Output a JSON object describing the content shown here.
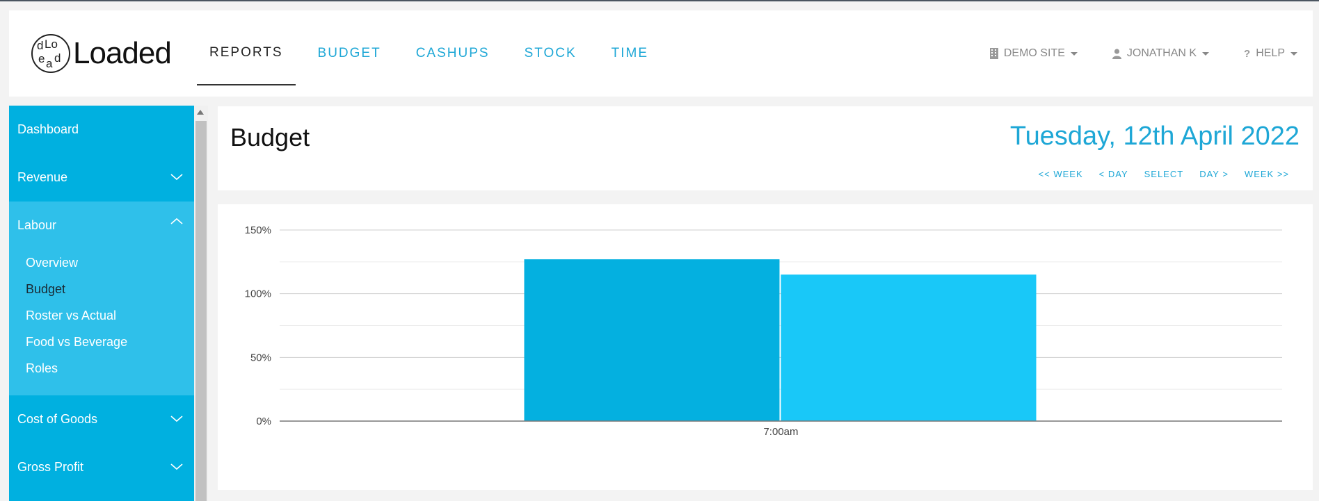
{
  "logo": {
    "mark_letters": [
      "d",
      "Lo",
      "e",
      "a",
      "d"
    ],
    "text": "Loaded"
  },
  "nav": [
    {
      "label": "REPORTS",
      "active": true
    },
    {
      "label": "BUDGET",
      "active": false
    },
    {
      "label": "CASHUPS",
      "active": false
    },
    {
      "label": "STOCK",
      "active": false
    },
    {
      "label": "TIME",
      "active": false
    }
  ],
  "user_menu": {
    "site": {
      "label": "DEMO SITE",
      "icon": "building-icon"
    },
    "user": {
      "label": "JONATHAN K",
      "icon": "user-icon"
    },
    "help": {
      "label": "HELP",
      "icon": "question-icon"
    }
  },
  "sidebar": {
    "items": [
      {
        "label": "Dashboard",
        "expandable": false
      },
      {
        "label": "Revenue",
        "expandable": true,
        "expanded": false
      },
      {
        "label": "Labour",
        "expandable": true,
        "expanded": true,
        "children": [
          "Overview",
          "Budget",
          "Roster vs Actual",
          "Food vs Beverage",
          "Roles"
        ],
        "current_child": "Budget"
      },
      {
        "label": "Cost of Goods",
        "expandable": true,
        "expanded": false
      },
      {
        "label": "Gross Profit",
        "expandable": true,
        "expanded": false
      }
    ]
  },
  "page": {
    "title": "Budget",
    "date": "Tuesday, 12th April 2022",
    "date_nav": [
      "<< WEEK",
      "< DAY",
      "SELECT",
      "DAY >",
      "WEEK >>"
    ]
  },
  "colors": {
    "accent": "#1ea7d6",
    "sidebar": "#00b0e0",
    "sidebar_open": "#2fc0ea",
    "bar1": "#04b0e0",
    "bar2": "#19c8f8"
  },
  "chart_data": {
    "type": "bar",
    "categories": [
      "7:00am"
    ],
    "series": [
      {
        "values": [
          127
        ]
      },
      {
        "values": [
          115
        ]
      }
    ],
    "ylim": [
      0,
      150
    ],
    "yticks": [
      "0%",
      "50%",
      "100%",
      "150%"
    ],
    "grid": true,
    "title": "",
    "xlabel": "",
    "ylabel": ""
  }
}
